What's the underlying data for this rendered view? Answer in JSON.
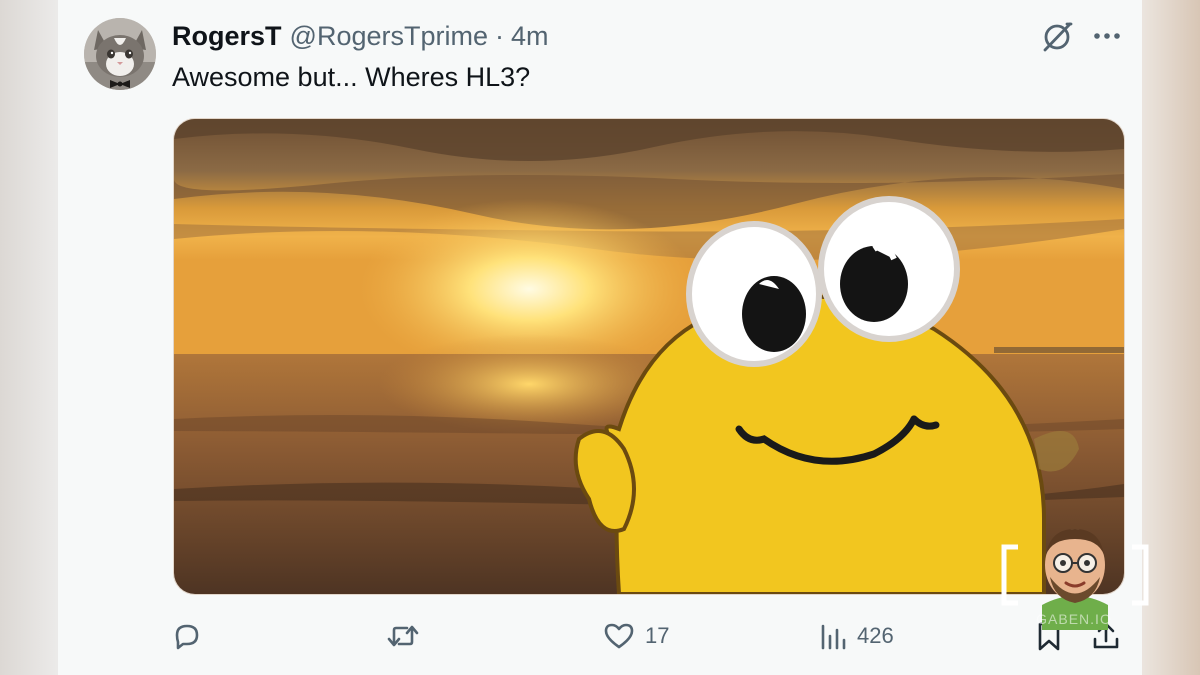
{
  "tweet": {
    "author": {
      "display_name": "RogersT",
      "handle": "@RogersTprime",
      "separator": "·",
      "time": "4m"
    },
    "text": "Awesome but... Wheres HL3?",
    "media": {
      "description_icon": "sunset-cartoon-gif"
    },
    "actions": {
      "reply_icon": "reply-icon",
      "retweet_icon": "retweet-icon",
      "like_icon": "heart-icon",
      "like_count": "17",
      "views_icon": "views-chart-icon",
      "views_count": "426",
      "bookmark_icon": "bookmark-icon",
      "share_icon": "share-icon"
    },
    "header_icons": {
      "grok": "grok-icon",
      "more": "more-icon"
    }
  },
  "watermark": {
    "text": "GABEN.IO"
  },
  "colors": {
    "text_primary": "#0f1419",
    "text_secondary": "#536471",
    "background": "#f7f9f9"
  }
}
